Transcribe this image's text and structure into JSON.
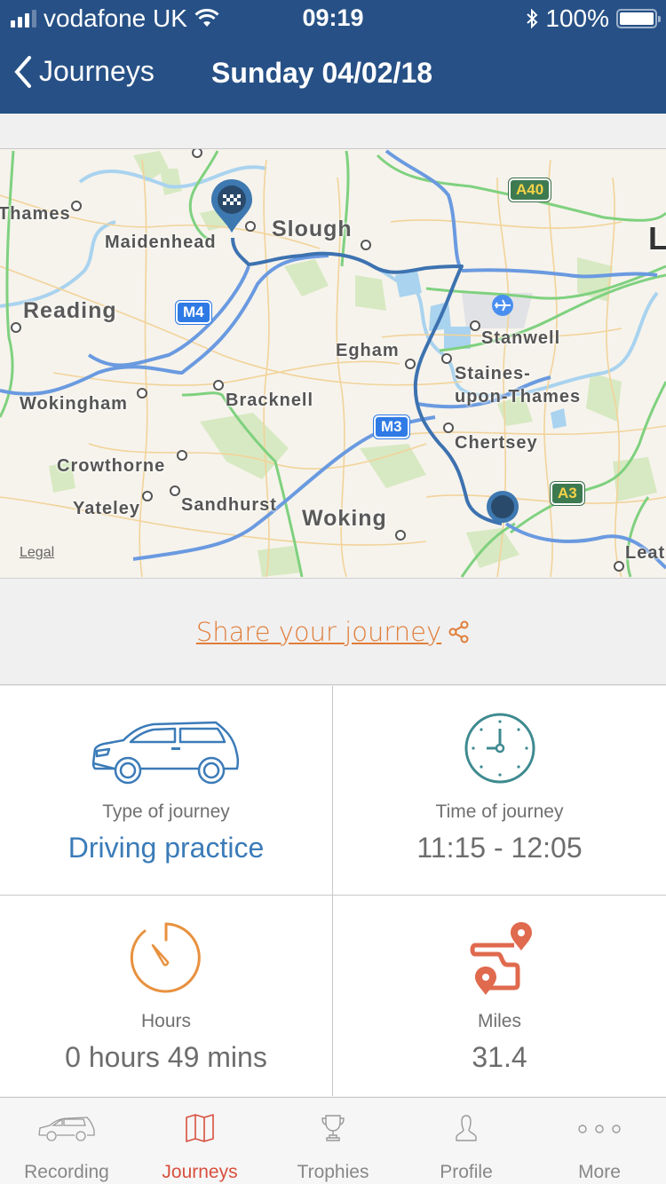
{
  "status_bar": {
    "carrier": "vodafone UK",
    "time": "09:19",
    "battery": "100%",
    "signal_bars_active": 3,
    "signal_bars_total": 4
  },
  "nav": {
    "back_label": "Journeys",
    "title": "Sunday 04/02/18"
  },
  "map": {
    "legal_label": "Legal",
    "places": [
      {
        "name": "Thames",
        "size": "med"
      },
      {
        "name": "Maidenhead",
        "size": "med"
      },
      {
        "name": "Slough",
        "size": "big"
      },
      {
        "name": "Reading",
        "size": "big"
      },
      {
        "name": "Egham",
        "size": "med"
      },
      {
        "name": "Stanwell",
        "size": "med"
      },
      {
        "name": "Staines-",
        "size": "med"
      },
      {
        "name": "upon-Thames",
        "size": "med"
      },
      {
        "name": "Wokingham",
        "size": "med"
      },
      {
        "name": "Bracknell",
        "size": "med"
      },
      {
        "name": "Chertsey",
        "size": "med"
      },
      {
        "name": "Crowthorne",
        "size": "med"
      },
      {
        "name": "Yateley",
        "size": "med"
      },
      {
        "name": "Sandhurst",
        "size": "med"
      },
      {
        "name": "Woking",
        "size": "big"
      },
      {
        "name": "Leat",
        "size": "med"
      },
      {
        "name": "L",
        "size": "big"
      }
    ],
    "road_badges": [
      {
        "name": "M4",
        "type": "motorway"
      },
      {
        "name": "M3",
        "type": "motorway"
      },
      {
        "name": "A40",
        "type": "aroad"
      },
      {
        "name": "A3",
        "type": "aroad"
      }
    ],
    "markers": {
      "end": "finish-flag",
      "start": "start-dot"
    }
  },
  "share": {
    "label": "Share your journey",
    "icon": "share-icon"
  },
  "stats": [
    {
      "icon": "car-icon",
      "label": "Type of journey",
      "value": "Driving practice"
    },
    {
      "icon": "clock-icon",
      "label": "Time of journey",
      "value": "11:15 - 12:05"
    },
    {
      "icon": "stopwatch-icon",
      "label": "Hours",
      "value": "0 hours 49 mins"
    },
    {
      "icon": "route-icon",
      "label": "Miles",
      "value": "31.4"
    }
  ],
  "tabs": [
    {
      "label": "Recording",
      "icon": "car-icon",
      "active": false
    },
    {
      "label": "Journeys",
      "icon": "map-icon",
      "active": true
    },
    {
      "label": "Trophies",
      "icon": "trophy-icon",
      "active": false
    },
    {
      "label": "Profile",
      "icon": "person-icon",
      "active": false
    },
    {
      "label": "More",
      "icon": "more-icon",
      "active": false
    }
  ],
  "colors": {
    "nav_bg": "#275186",
    "accent_orange": "#e07d3a",
    "accent_blue": "#3b7bb8",
    "active_tab": "#d8503f",
    "clock_teal": "#3e8a90",
    "route_red": "#e06a4e"
  }
}
